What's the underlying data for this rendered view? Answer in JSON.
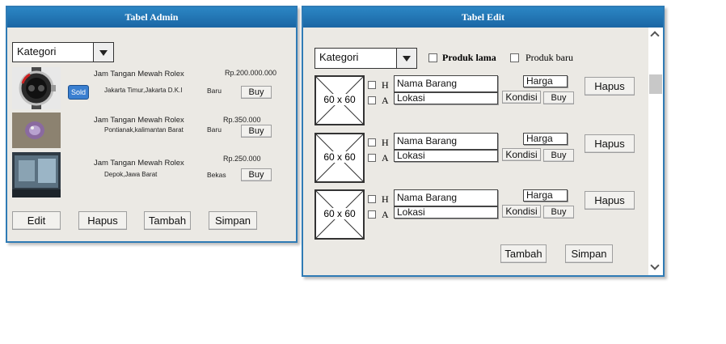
{
  "admin": {
    "title": "Tabel Admin",
    "category_select": "Kategori",
    "items": [
      {
        "name": "Jam Tangan Mewah Rolex",
        "price": "Rp.200.000.000",
        "location": "Jakarta Timur,Jakarta D.K.I",
        "condition": "Baru",
        "buy": "Buy",
        "badge": "Sold"
      },
      {
        "name": "Jam Tangan Mewah Rolex",
        "price": "Rp.350.000",
        "location": "Pontianak,kalimantan Barat",
        "condition": "Baru",
        "buy": "Buy"
      },
      {
        "name": "Jam Tangan Mewah Rolex",
        "price": "Rp.250.000",
        "location": "Depok,Jawa Barat",
        "condition": "Bekas",
        "buy": "Buy"
      }
    ],
    "buttons": {
      "edit": "Edit",
      "hapus": "Hapus",
      "tambah": "Tambah",
      "simpan": "Simpan"
    }
  },
  "edit": {
    "title": "Tabel Edit",
    "category_select": "Kategori",
    "filter_lama": "Produk lama",
    "filter_baru": "Produk baru",
    "rows": [
      {
        "placeholder": "60 x 60",
        "check_h": "H",
        "check_a": "A",
        "nama": "Nama Barang",
        "lokasi": "Lokasi",
        "harga": "Harga",
        "kondisi": "Kondisi",
        "buy": "Buy",
        "hapus": "Hapus"
      },
      {
        "placeholder": "60 x 60",
        "check_h": "H",
        "check_a": "A",
        "nama": "Nama Barang",
        "lokasi": "Lokasi",
        "harga": "Harga",
        "kondisi": "Kondisi",
        "buy": "Buy",
        "hapus": "Hapus"
      },
      {
        "placeholder": "60 x 60",
        "check_h": "H",
        "check_a": "A",
        "nama": "Nama Barang",
        "lokasi": "Lokasi",
        "harga": "Harga",
        "kondisi": "Kondisi",
        "buy": "Buy",
        "hapus": "Hapus"
      }
    ],
    "buttons": {
      "tambah": "Tambah",
      "simpan": "Simpan"
    },
    "scroll_icons": [
      "chevron-up-icon",
      "chevron-down-icon"
    ]
  }
}
